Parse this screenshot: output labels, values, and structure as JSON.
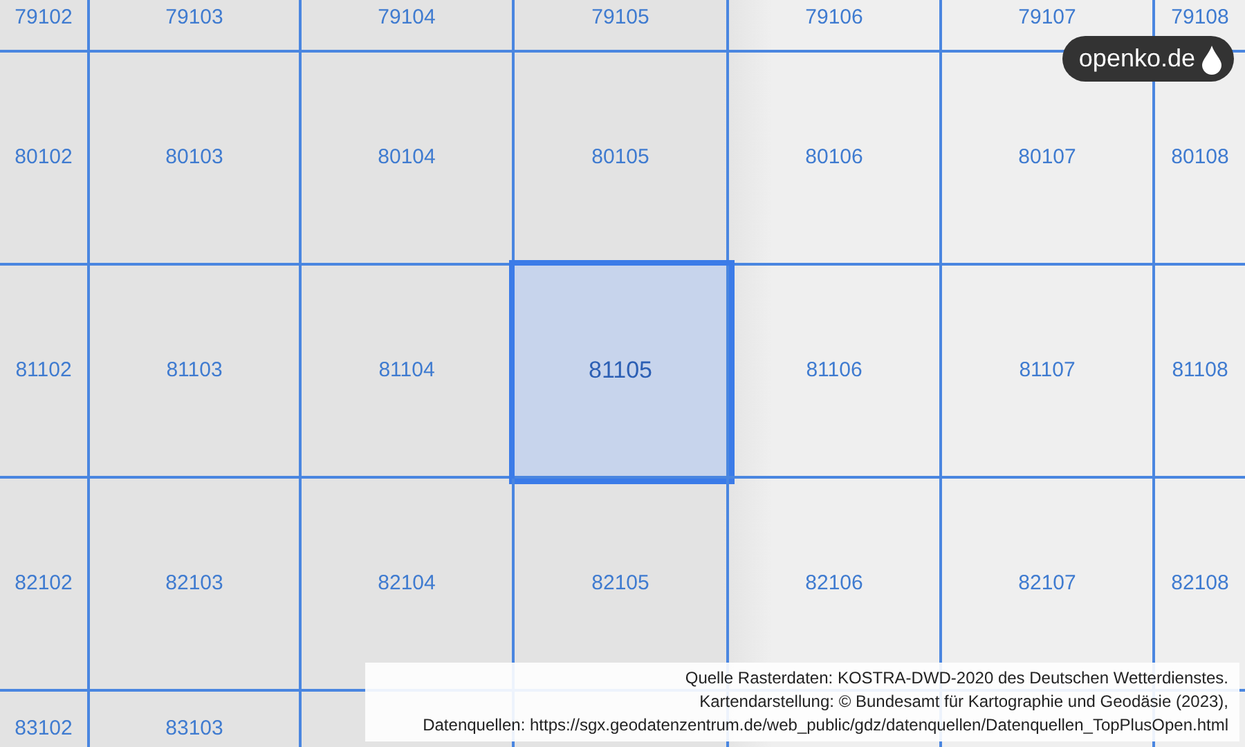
{
  "grid": {
    "rows": [
      {
        "cells": [
          {
            "label": "79102",
            "selected": false
          },
          {
            "label": "79103",
            "selected": false
          },
          {
            "label": "79104",
            "selected": false
          },
          {
            "label": "79105",
            "selected": false
          },
          {
            "label": "79106",
            "selected": false
          },
          {
            "label": "79107",
            "selected": false
          },
          {
            "label": "79108",
            "selected": false
          }
        ]
      },
      {
        "cells": [
          {
            "label": "80102",
            "selected": false
          },
          {
            "label": "80103",
            "selected": false
          },
          {
            "label": "80104",
            "selected": false
          },
          {
            "label": "80105",
            "selected": false
          },
          {
            "label": "80106",
            "selected": false
          },
          {
            "label": "80107",
            "selected": false
          },
          {
            "label": "80108",
            "selected": false
          }
        ]
      },
      {
        "cells": [
          {
            "label": "81102",
            "selected": false
          },
          {
            "label": "81103",
            "selected": false
          },
          {
            "label": "81104",
            "selected": false
          },
          {
            "label": "81105",
            "selected": true
          },
          {
            "label": "81106",
            "selected": false
          },
          {
            "label": "81107",
            "selected": false
          },
          {
            "label": "81108",
            "selected": false
          }
        ]
      },
      {
        "cells": [
          {
            "label": "82102",
            "selected": false
          },
          {
            "label": "82103",
            "selected": false
          },
          {
            "label": "82104",
            "selected": false
          },
          {
            "label": "82105",
            "selected": false
          },
          {
            "label": "82106",
            "selected": false
          },
          {
            "label": "82107",
            "selected": false
          },
          {
            "label": "82108",
            "selected": false
          }
        ]
      },
      {
        "cells": [
          {
            "label": "83102",
            "selected": false
          },
          {
            "label": "83103",
            "selected": false
          }
        ]
      }
    ]
  },
  "logo": {
    "text": "openko.de"
  },
  "attribution": [
    "Quelle Rasterdaten: KOSTRA-DWD-2020 des Deutschen Wetterdienstes.",
    "Kartendarstellung: © Bundesamt für Kartographie und Geodäsie (2023),",
    "Datenquellen: https://sgx.geodatenzentrum.de/web_public/gdz/datenquellen/Datenquellen_TopPlusOpen.html"
  ]
}
